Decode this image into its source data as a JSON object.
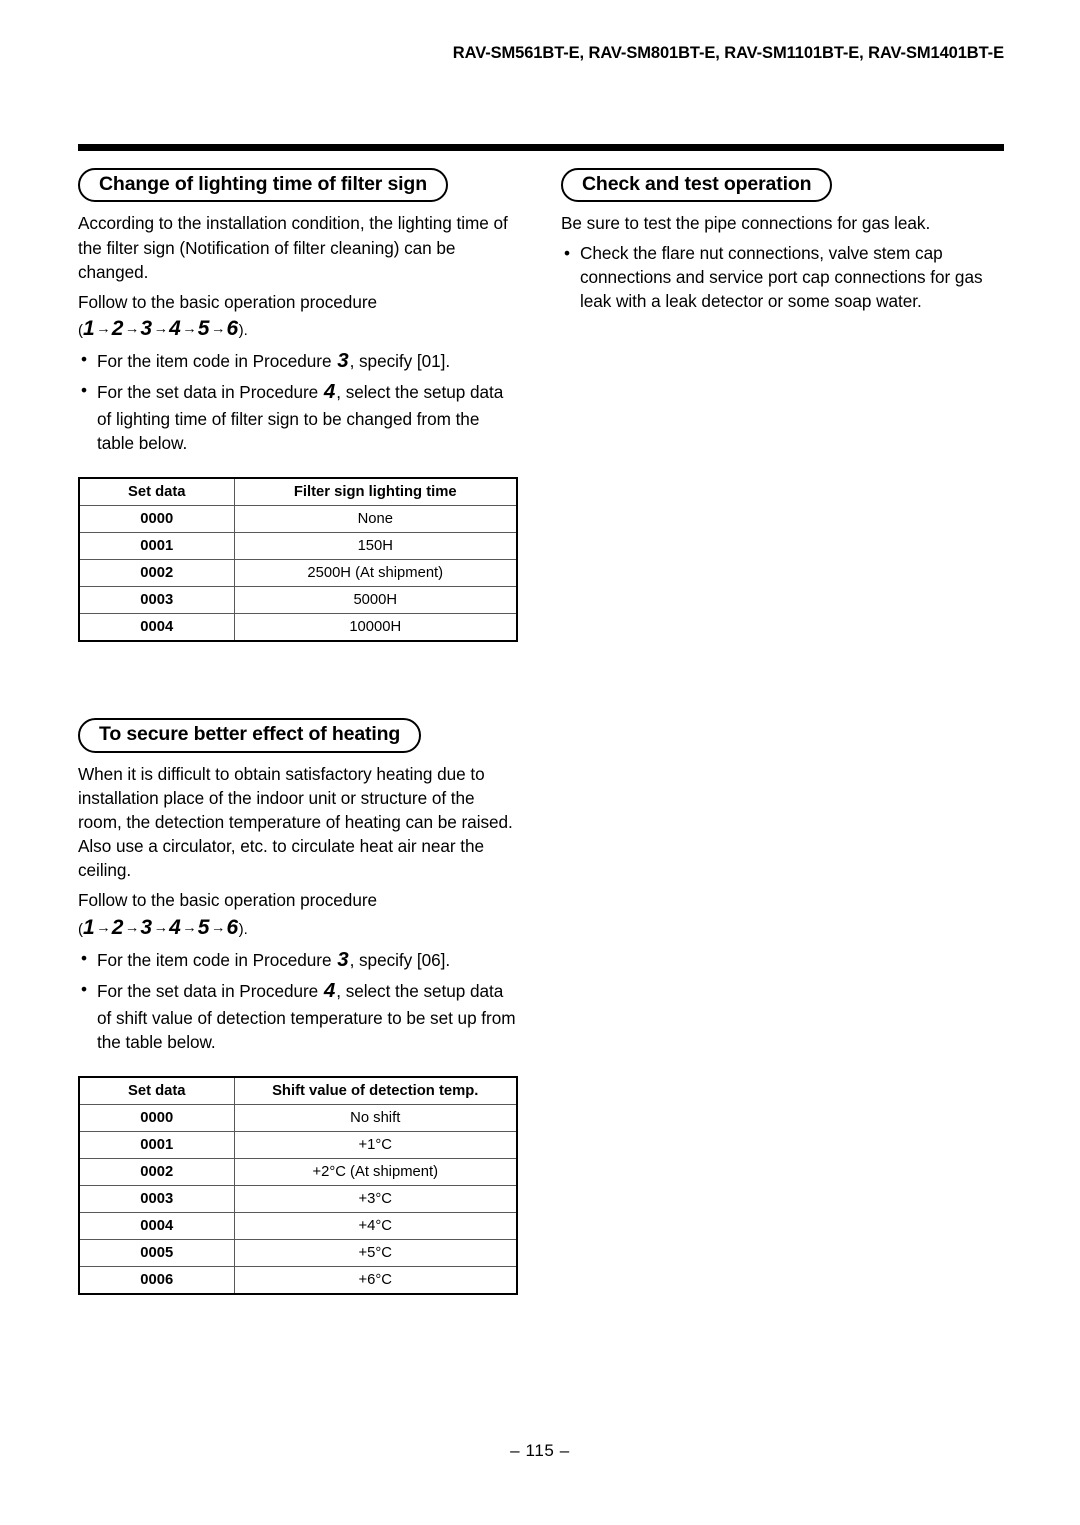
{
  "header": {
    "model_line": "RAV-SM561BT-E, RAV-SM801BT-E, RAV-SM1101BT-E, RAV-SM1401BT-E"
  },
  "footer": {
    "page_number": "– 115 –"
  },
  "left_column": {
    "section_filter": {
      "heading": "Change of lighting time of filter sign",
      "paragraph": "According to the installation condition, the lighting time of the filter sign (Notification of filter cleaning) can be changed.",
      "follow_text": "Follow to the basic operation procedure",
      "sequence": {
        "open_paren": "(",
        "steps": [
          "1",
          "2",
          "3",
          "4",
          "5",
          "6"
        ],
        "arrow": "→",
        "close_paren": ").",
        "full_text": "( 1 → 2 → 3 → 4 → 5 → 6 )."
      },
      "bullets": [
        {
          "before": "For the item code in Procedure ",
          "procedure": "3",
          "after": ", specify [01]."
        },
        {
          "before": "For the set data in Procedure ",
          "procedure": "4",
          "after": ", select the setup data of lighting time of filter sign to be changed from the table below."
        }
      ],
      "table": {
        "headers": [
          "Set data",
          "Filter sign lighting time"
        ],
        "rows": [
          [
            "0000",
            "None"
          ],
          [
            "0001",
            "150H"
          ],
          [
            "0002",
            "2500H (At shipment)"
          ],
          [
            "0003",
            "5000H"
          ],
          [
            "0004",
            "10000H"
          ]
        ]
      }
    },
    "section_heating": {
      "heading": "To secure better effect of heating",
      "paragraph": "When it is difficult to obtain satisfactory heating due to installation place of the indoor unit or structure of the room, the detection temperature of heating can be raised. Also use a circulator, etc. to circulate heat air near the ceiling.",
      "follow_text": "Follow to the basic operation procedure",
      "sequence": {
        "open_paren": "(",
        "steps": [
          "1",
          "2",
          "3",
          "4",
          "5",
          "6"
        ],
        "arrow": "→",
        "close_paren": ").",
        "full_text": "( 1 → 2 → 3 → 4 → 5 → 6 )."
      },
      "bullets": [
        {
          "before": "For the item code in Procedure ",
          "procedure": "3",
          "after": ", specify [06]."
        },
        {
          "before": "For the set data in Procedure ",
          "procedure": "4",
          "after": ", select the setup data of shift value of detection temperature to be set up from the table below."
        }
      ],
      "table": {
        "headers": [
          "Set data",
          "Shift value of detection temp."
        ],
        "rows": [
          [
            "0000",
            "No shift"
          ],
          [
            "0001",
            "+1°C"
          ],
          [
            "0002",
            "+2°C (At shipment)"
          ],
          [
            "0003",
            "+3°C"
          ],
          [
            "0004",
            "+4°C"
          ],
          [
            "0005",
            "+5°C"
          ],
          [
            "0006",
            "+6°C"
          ]
        ]
      }
    }
  },
  "right_column": {
    "section_check": {
      "heading": "Check and test operation",
      "paragraph": "Be sure to test the pipe connections for gas leak.",
      "bullets": [
        {
          "before": "Check the flare nut connections, valve stem cap connections and service port cap connections for gas leak with a leak detector or some soap water.",
          "procedure": "",
          "after": ""
        }
      ]
    }
  },
  "bullet_glyph": "•"
}
